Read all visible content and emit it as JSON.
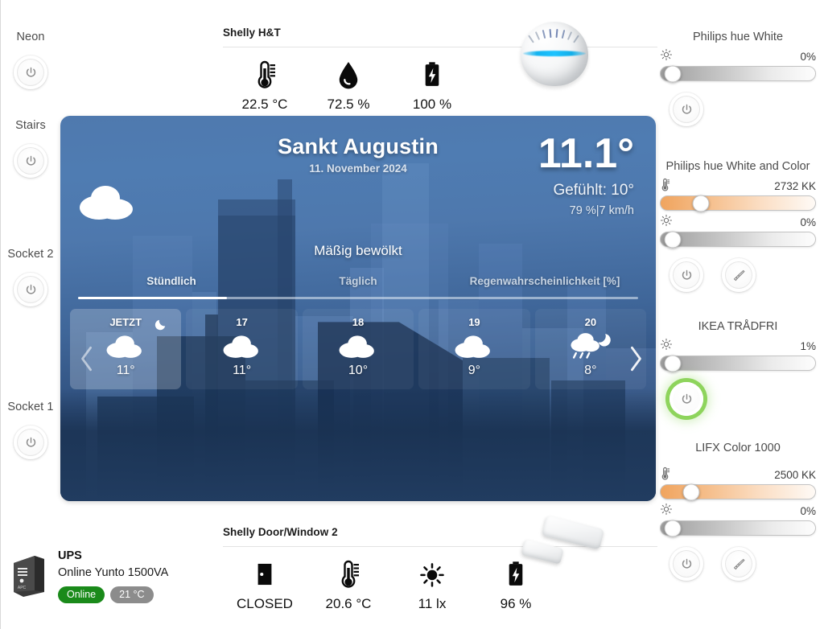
{
  "left_sidebar": {
    "items": [
      {
        "label": "Neon",
        "power_icon": "power-icon",
        "state": "off"
      },
      {
        "label": "Stairs",
        "power_icon": "power-icon",
        "state": "off"
      },
      {
        "label": "Socket 2",
        "power_icon": "power-icon",
        "state": "off"
      },
      {
        "label": "Socket 1",
        "power_icon": "power-icon",
        "state": "off"
      }
    ]
  },
  "ups": {
    "device_icon": "ups-device-icon",
    "name": "UPS",
    "model": "Online Yunto 1500VA",
    "status_badge": "Online",
    "status_color": "#1a8a1a",
    "temp_badge": "21 °C",
    "temp_color": "#8c8c8c"
  },
  "sensor_top": {
    "title": "Shelly H&T",
    "device_icon": "shelly-ht-device-icon",
    "metrics": [
      {
        "icon": "thermometer-icon",
        "value": "22.5 °C"
      },
      {
        "icon": "humidity-drop-icon",
        "value": "72.5 %"
      },
      {
        "icon": "battery-icon",
        "value": "100 %"
      }
    ]
  },
  "sensor_bottom": {
    "title": "Shelly Door/Window 2",
    "device_icon": "door-window-sensor-icon",
    "metrics": [
      {
        "icon": "door-closed-icon",
        "value": "CLOSED"
      },
      {
        "icon": "thermometer-icon",
        "value": "20.6 °C"
      },
      {
        "icon": "sun-lux-icon",
        "value": "11 lx"
      },
      {
        "icon": "battery-icon",
        "value": "96 %"
      }
    ]
  },
  "weather": {
    "city": "Sankt Augustin",
    "date": "11. November 2024",
    "temperature": "11.1°",
    "feels_like": "Gefühlt: 10°",
    "humidity_wind": "79 %|7 km/h",
    "condition": "Mäßig bewölkt",
    "condition_icon": "cloud-icon",
    "tabs": [
      {
        "label": "Stündlich",
        "active": true
      },
      {
        "label": "Täglich",
        "active": false
      },
      {
        "label": "Regenwahrscheinlichkeit [%]",
        "active": false
      }
    ],
    "prev_icon": "chevron-left-icon",
    "next_icon": "chevron-right-icon",
    "hours": [
      {
        "label": "JETZT",
        "icon": "cloud-icon",
        "temp": "11°",
        "selected": true,
        "moon": true
      },
      {
        "label": "17",
        "icon": "cloud-icon",
        "temp": "11°",
        "selected": false,
        "moon": false
      },
      {
        "label": "18",
        "icon": "cloud-icon",
        "temp": "10°",
        "selected": false,
        "moon": false
      },
      {
        "label": "19",
        "icon": "cloud-icon",
        "temp": "9°",
        "selected": false,
        "moon": false
      },
      {
        "label": "20",
        "icon": "rain-moon-icon",
        "temp": "8°",
        "selected": false,
        "moon": false
      }
    ]
  },
  "right_sidebar": {
    "groups": [
      {
        "title": "Philips hue White",
        "sliders": [
          {
            "icon": "brightness-icon",
            "value": "0%",
            "kind": "bright",
            "pos": 8
          }
        ],
        "buttons": {
          "power": true,
          "power_state": "off",
          "paint": false
        }
      },
      {
        "title": "Philips hue White and Color",
        "sliders": [
          {
            "icon": "color-temp-icon",
            "value": "2732 KK",
            "kind": "temp",
            "pos": 26
          },
          {
            "icon": "brightness-icon",
            "value": "0%",
            "kind": "bright",
            "pos": 8
          }
        ],
        "buttons": {
          "power": true,
          "power_state": "off",
          "paint": true
        }
      },
      {
        "title": "IKEA TRÅDFRI",
        "sliders": [
          {
            "icon": "brightness-icon",
            "value": "1%",
            "kind": "bright",
            "pos": 8
          }
        ],
        "buttons": {
          "power": true,
          "power_state": "on",
          "paint": false
        }
      },
      {
        "title": "LIFX Color 1000",
        "sliders": [
          {
            "icon": "color-temp-icon",
            "value": "2500 KK",
            "kind": "temp",
            "pos": 20
          },
          {
            "icon": "brightness-icon",
            "value": "0%",
            "kind": "bright",
            "pos": 8
          }
        ],
        "buttons": {
          "power": true,
          "power_state": "off",
          "paint": true
        }
      }
    ]
  },
  "colors": {
    "accent_blue": "#1ec3ff",
    "online_green": "#1a8a1a",
    "on_glow_green": "#8fd35e",
    "warm_white": "#f0a45e",
    "weather_top": "#4f79ae",
    "weather_bottom": "#1e3758"
  }
}
